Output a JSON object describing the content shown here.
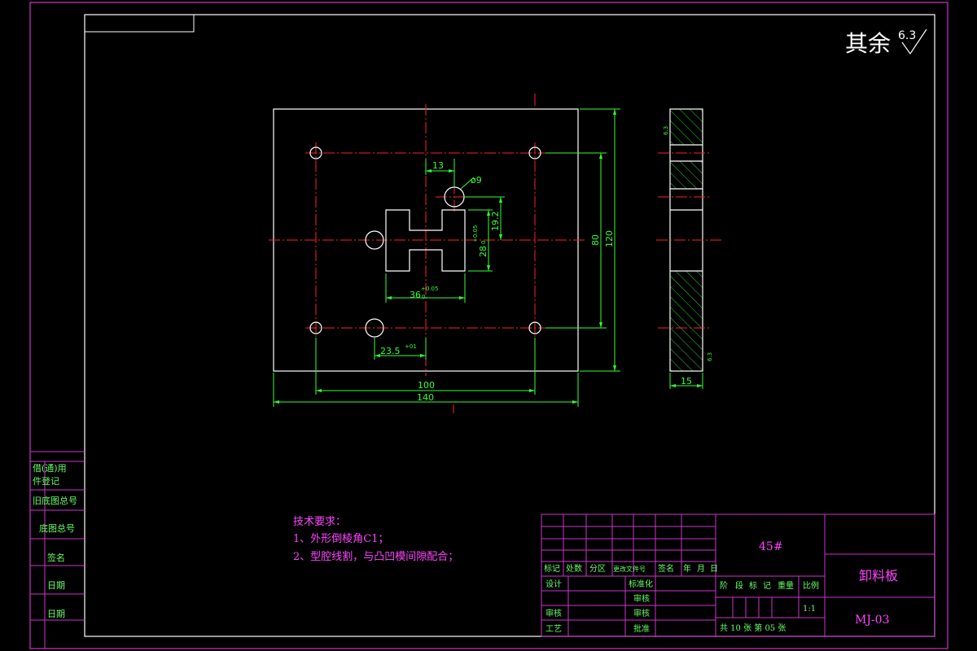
{
  "colors": {
    "background": "#000000",
    "border": "#cc33cc",
    "outline": "#ffffff",
    "dimension": "#33ff33",
    "centerline": "#ff2020",
    "tech_text": "#ff44ff",
    "hatch": "#33ff33",
    "title_text": "#ff44ff",
    "side_text": "#66ff66"
  },
  "roughness": {
    "prefix": "其余",
    "value": "6.3"
  },
  "dimensions": {
    "d13": "13",
    "hole_dia": "ø9",
    "d19_2": "19.2",
    "d28": "28",
    "d28_tol": "+0.05",
    "d28_tol2": "0",
    "d36": "36",
    "d36_tol": "+0.05",
    "d36_tol2": "0",
    "d23_5": "23.5",
    "d23_5_tol": "+01",
    "d100": "100",
    "d140": "140",
    "d80": "80",
    "d120": "120",
    "d15": "15",
    "rough_a": "6.3",
    "rough_b": "6.3"
  },
  "tech_requirements": {
    "heading": "技术要求：",
    "items": [
      "1、外形倒棱角C1；",
      "2、型腔线割，与凸凹模间隙配合；"
    ]
  },
  "side_labels": [
    "借(通)用",
    "件登记",
    "旧底图总号",
    "底图总号",
    "签名",
    "日期",
    "日期"
  ],
  "title_block": {
    "material": "45#",
    "part_name": "卸料板",
    "drawing_no": "MJ-03",
    "header_row": [
      "标记",
      "处数",
      "分区",
      "更改文件号",
      "签名",
      "年",
      "月",
      "日"
    ],
    "design": "设计",
    "standardization": "标准化",
    "check": "审核",
    "craft": "工艺",
    "proofread": "审核",
    "stage_row": [
      "阶",
      "段",
      "标",
      "记",
      "重量",
      "比例"
    ],
    "scale": "1:1",
    "review": "审核",
    "approve": "批准",
    "sheets": "共 10 张  第 05 张"
  }
}
